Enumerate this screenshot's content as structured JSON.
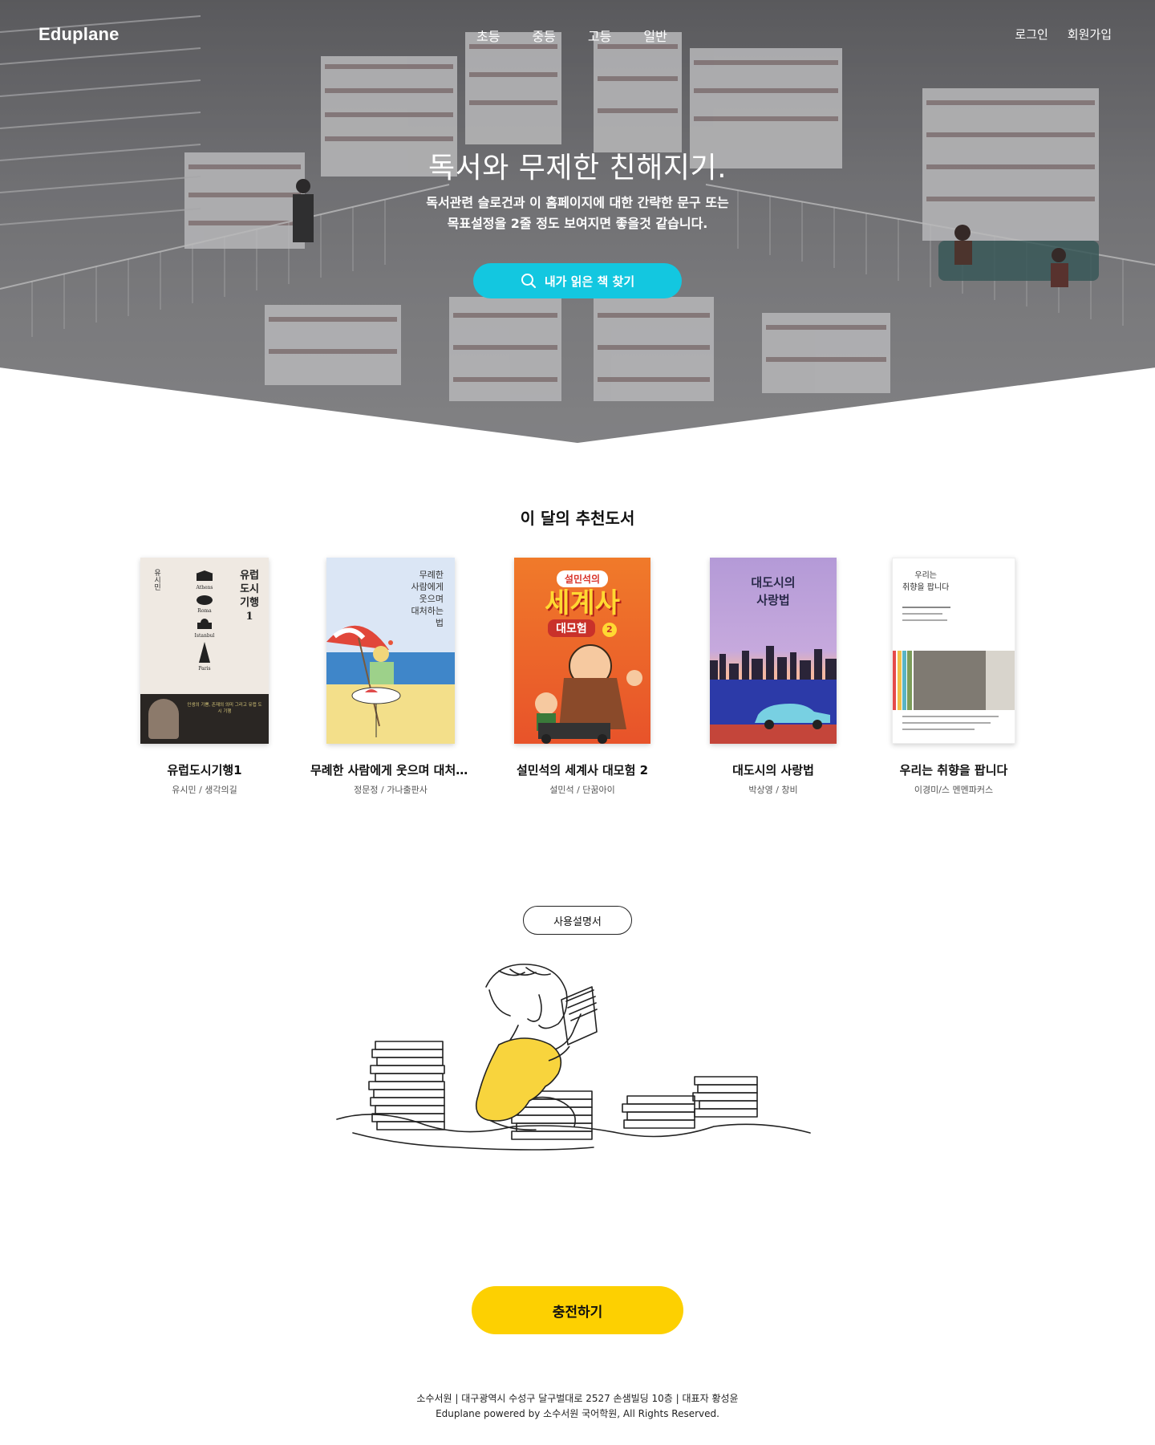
{
  "nav": {
    "logo": "Eduplane",
    "menu": [
      "초등",
      "중등",
      "고등",
      "일반"
    ],
    "login": "로그인",
    "signup": "회원가입"
  },
  "hero": {
    "title": "독서와 무제한 친해지기.",
    "subtitle_line1": "독서관련 슬로건과 이 홈페이지에 대한 간략한 문구 또는",
    "subtitle_line2": "목표설정을 2줄 정도 보여지면 좋을것 같습니다.",
    "search_button": "내가 읽은 책 찾기",
    "search_icon": "search-icon"
  },
  "recommended": {
    "title": "이 달의 추천도서",
    "books": [
      {
        "title": "유럽도시기행1",
        "author": "유시민 / 생각의길",
        "cover_lines": [
          "유럽",
          "도시",
          "기행",
          "1"
        ],
        "cover_cities": [
          "Athens",
          "Roma",
          "Istanbul",
          "Paris"
        ],
        "cover_author": "유시민",
        "cover_tagline": "인생의 기쁨, 존재의 의미 그리고 유럽 도시 기행"
      },
      {
        "title": "무례한 사람에게 웃으며 대처하는 법",
        "author": "정문정 / 가나출판사",
        "cover_lines": [
          "무례한",
          "사람에게",
          "웃으며",
          "대처하는",
          "법"
        ]
      },
      {
        "title": "설민석의 세계사 대모험 2",
        "author": "설민석 / 단꿈아이",
        "cover_lines": [
          "설민석의",
          "세계사",
          "대모험",
          "2"
        ]
      },
      {
        "title": "대도시의 사랑법",
        "author": "박상영 / 창비",
        "cover_lines": [
          "대도시의",
          "사랑법"
        ]
      },
      {
        "title": "우리는 취향을 팝니다",
        "author": "이경미/스 멘멘파커스",
        "cover_lines": [
          "우리는",
          "취향을 팝니다"
        ]
      }
    ]
  },
  "guide": {
    "button": "사용설명서"
  },
  "charge": {
    "button": "충전하기"
  },
  "footer": {
    "line1": "소수서원 | 대구광역시 수성구 달구벌대로 2527 손샘빌딩 10층 | 대표자 황성윤",
    "line2": "Eduplane powered by 소수서원 국어학원, All Rights Reserved."
  },
  "colors": {
    "accent_cyan": "#13c7e0",
    "accent_yellow": "#fdd001"
  }
}
